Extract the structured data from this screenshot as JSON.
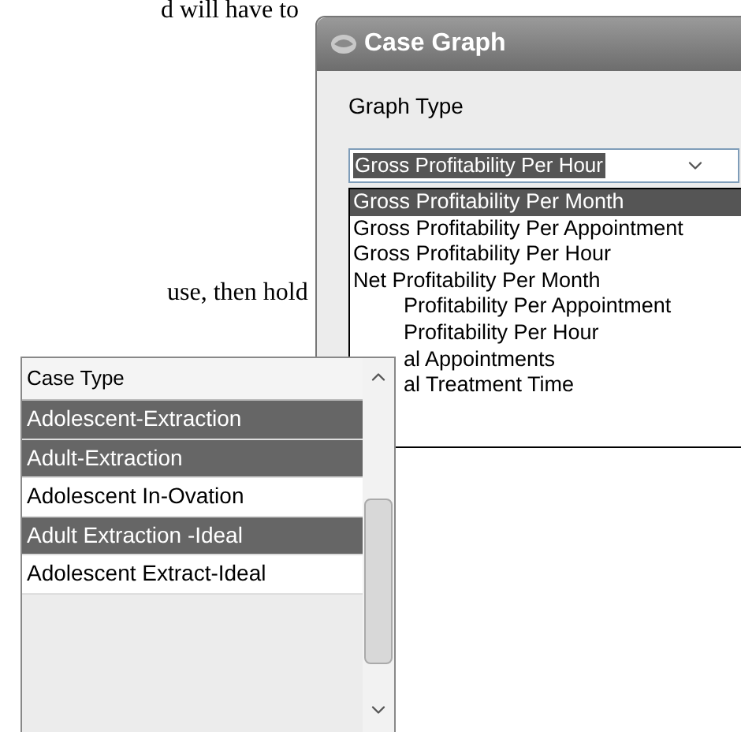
{
  "page_text": [
    {
      "text": "d will have to"
    },
    {
      "text": "use, then hold"
    }
  ],
  "window": {
    "title": "Case Graph",
    "graph_type_label": "Graph Type",
    "combo_value": "Gross Profitability Per Hour",
    "options": [
      {
        "label": "Gross Profitability Per Month",
        "selected": true,
        "kind": "full"
      },
      {
        "label": "Gross Profitability Per Appointment",
        "selected": false,
        "kind": "full"
      },
      {
        "label": "Gross Profitability Per Hour",
        "selected": false,
        "kind": "full"
      },
      {
        "label": "Net Profitability Per Month",
        "selected": false,
        "kind": "full"
      },
      {
        "label": "Profitability Per Appointment",
        "selected": false,
        "kind": "covered"
      },
      {
        "label": "Profitability Per Hour",
        "selected": false,
        "kind": "covered"
      },
      {
        "label": "al Appointments",
        "selected": false,
        "kind": "covered"
      },
      {
        "label": "al Treatment Time",
        "selected": false,
        "kind": "covered"
      }
    ]
  },
  "case_list": {
    "header": "Case Type",
    "rows": [
      {
        "label": "Adolescent-Extraction",
        "selected": true
      },
      {
        "label": "Adult-Extraction",
        "selected": true
      },
      {
        "label": "Adolescent In-Ovation",
        "selected": false
      },
      {
        "label": "Adult Extraction -Ideal",
        "selected": true
      },
      {
        "label": "Adolescent Extract-Ideal",
        "selected": false
      }
    ]
  }
}
